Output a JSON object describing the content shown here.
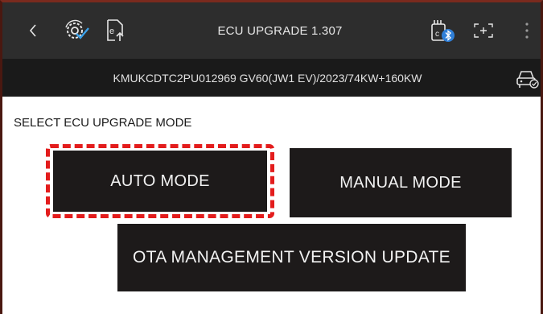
{
  "header": {
    "title": "ECU UPGRADE 1.307",
    "icons": [
      "back-arrow-icon",
      "gear-check-icon",
      "ecu-upload-icon",
      "bluetooth-vci-icon",
      "fullscreen-icon",
      "more-vertical-icon"
    ]
  },
  "vehicle": {
    "info": "KMUKCDTC2PU012969  GV60(JW1 EV)/2023/74KW+160KW",
    "icon": "vehicle-status-icon"
  },
  "main": {
    "section_label": "SELECT ECU UPGRADE MODE",
    "buttons": {
      "auto": "AUTO MODE",
      "manual": "MANUAL MODE",
      "ota": "OTA MANAGEMENT VERSION UPDATE"
    },
    "highlight_color": "#e31c1c"
  },
  "colors": {
    "topbar_bg": "#2d2d2d",
    "subbar_bg": "#1a1a1a",
    "button_bg": "#1d1a1a"
  }
}
